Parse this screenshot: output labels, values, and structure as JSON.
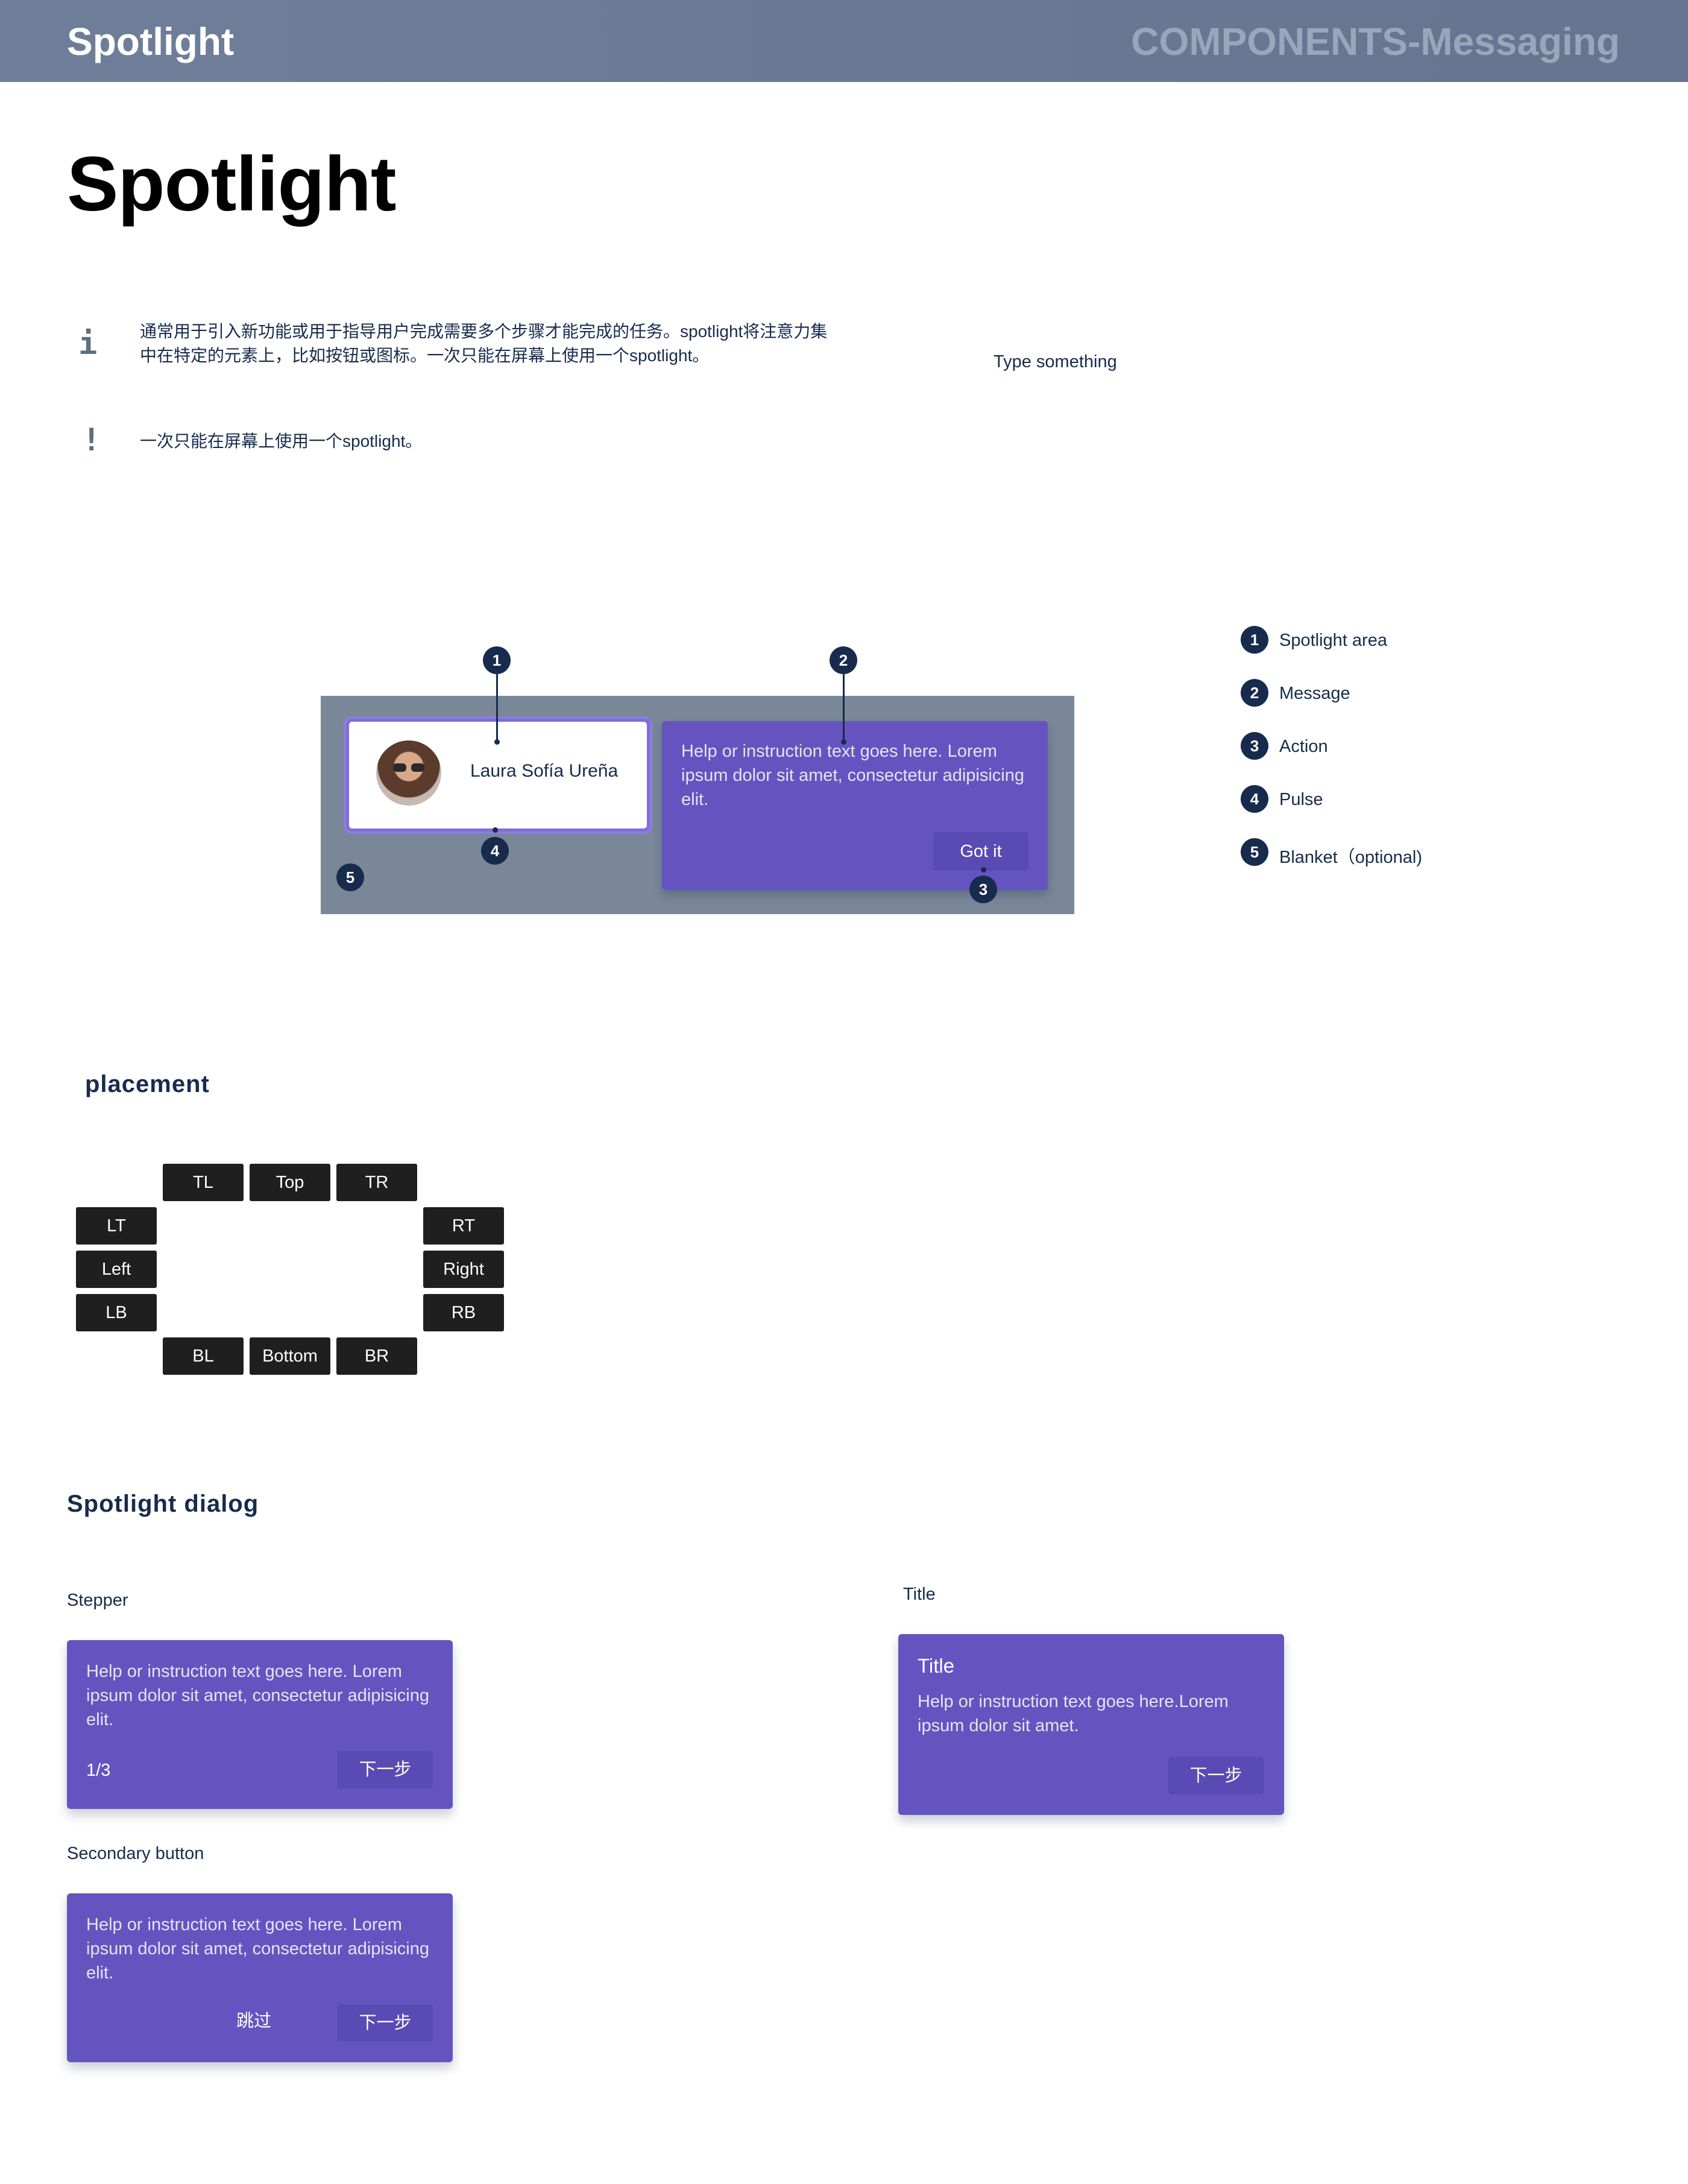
{
  "header": {
    "left_title": "Spotlight",
    "right_title": "COMPONENTS-Messaging"
  },
  "page_title": "Spotlight",
  "info": {
    "icon_char": "i",
    "text": "通常用于引入新功能或用于指导用户完成需要多个步骤才能完成的任务。spotlight将注意力集中在特定的元素上，比如按钮或图标。一次只能在屏幕上使用一个spotlight。"
  },
  "warning": {
    "icon_char": "!",
    "text": "一次只能在屏幕上使用一个spotlight。"
  },
  "type_something": "Type something",
  "anatomy": {
    "spotlight_name": "Laura Sofía Ureña",
    "message_text": "Help or  instruction text goes here. Lorem ipsum dolor sit amet, consectetur adipisicing elit.",
    "action_label": "Got it",
    "markers": [
      "1",
      "2",
      "3",
      "4",
      "5"
    ]
  },
  "legend": [
    {
      "num": "1",
      "label": "Spotlight area"
    },
    {
      "num": "2",
      "label": "Message"
    },
    {
      "num": "3",
      "label": "Action"
    },
    {
      "num": "4",
      "label": "Pulse"
    },
    {
      "num": "5",
      "label": "Blanket（optional)"
    }
  ],
  "placement": {
    "heading": "placement",
    "buttons": {
      "tl": "TL",
      "top": "Top",
      "tr": "TR",
      "lt": "LT",
      "left": "Left",
      "lb": "LB",
      "rt": "RT",
      "right": "Right",
      "rb": "RB",
      "bl": "BL",
      "bottom": "Bottom",
      "br": "BR"
    }
  },
  "dialog": {
    "heading": "Spotlight dialog",
    "stepper": {
      "label": "Stepper",
      "text": "Help or  instruction text goes here. Lorem ipsum dolor sit amet, consectetur adipisicing elit.",
      "step": "1/3",
      "next": "下一步"
    },
    "secondary": {
      "label": "Secondary button",
      "text": "Help or  instruction text goes here. Lorem ipsum dolor sit amet, consectetur adipisicing elit.",
      "skip": "跳过",
      "next": "下一步"
    },
    "titled": {
      "label": "Title",
      "title": "Title",
      "text": "Help or instruction text goes here.Lorem ipsum dolor sit amet.",
      "next": "下一步"
    }
  },
  "colors": {
    "header_bg": "#6f7f99",
    "spotlight_purple": "#6554c0",
    "marker_navy": "#172b4d",
    "blanket_gray": "#7a8799",
    "placement_button": "#1f1f1f"
  }
}
